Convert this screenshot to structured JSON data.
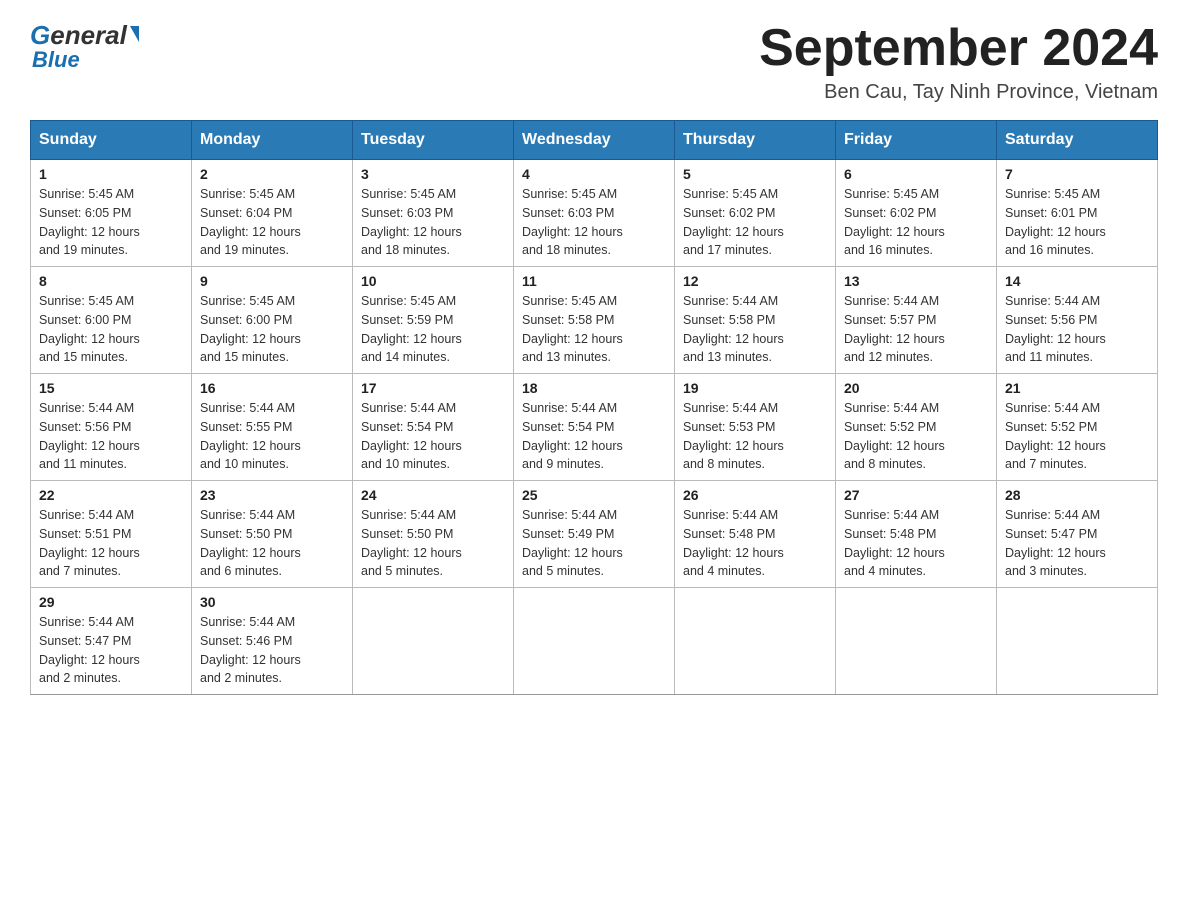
{
  "header": {
    "logo_general": "General",
    "logo_blue": "Blue",
    "main_title": "September 2024",
    "subtitle": "Ben Cau, Tay Ninh Province, Vietnam"
  },
  "columns": [
    "Sunday",
    "Monday",
    "Tuesday",
    "Wednesday",
    "Thursday",
    "Friday",
    "Saturday"
  ],
  "weeks": [
    [
      {
        "day": "1",
        "sunrise": "5:45 AM",
        "sunset": "6:05 PM",
        "daylight": "12 hours and 19 minutes."
      },
      {
        "day": "2",
        "sunrise": "5:45 AM",
        "sunset": "6:04 PM",
        "daylight": "12 hours and 19 minutes."
      },
      {
        "day": "3",
        "sunrise": "5:45 AM",
        "sunset": "6:03 PM",
        "daylight": "12 hours and 18 minutes."
      },
      {
        "day": "4",
        "sunrise": "5:45 AM",
        "sunset": "6:03 PM",
        "daylight": "12 hours and 18 minutes."
      },
      {
        "day": "5",
        "sunrise": "5:45 AM",
        "sunset": "6:02 PM",
        "daylight": "12 hours and 17 minutes."
      },
      {
        "day": "6",
        "sunrise": "5:45 AM",
        "sunset": "6:02 PM",
        "daylight": "12 hours and 16 minutes."
      },
      {
        "day": "7",
        "sunrise": "5:45 AM",
        "sunset": "6:01 PM",
        "daylight": "12 hours and 16 minutes."
      }
    ],
    [
      {
        "day": "8",
        "sunrise": "5:45 AM",
        "sunset": "6:00 PM",
        "daylight": "12 hours and 15 minutes."
      },
      {
        "day": "9",
        "sunrise": "5:45 AM",
        "sunset": "6:00 PM",
        "daylight": "12 hours and 15 minutes."
      },
      {
        "day": "10",
        "sunrise": "5:45 AM",
        "sunset": "5:59 PM",
        "daylight": "12 hours and 14 minutes."
      },
      {
        "day": "11",
        "sunrise": "5:45 AM",
        "sunset": "5:58 PM",
        "daylight": "12 hours and 13 minutes."
      },
      {
        "day": "12",
        "sunrise": "5:44 AM",
        "sunset": "5:58 PM",
        "daylight": "12 hours and 13 minutes."
      },
      {
        "day": "13",
        "sunrise": "5:44 AM",
        "sunset": "5:57 PM",
        "daylight": "12 hours and 12 minutes."
      },
      {
        "day": "14",
        "sunrise": "5:44 AM",
        "sunset": "5:56 PM",
        "daylight": "12 hours and 11 minutes."
      }
    ],
    [
      {
        "day": "15",
        "sunrise": "5:44 AM",
        "sunset": "5:56 PM",
        "daylight": "12 hours and 11 minutes."
      },
      {
        "day": "16",
        "sunrise": "5:44 AM",
        "sunset": "5:55 PM",
        "daylight": "12 hours and 10 minutes."
      },
      {
        "day": "17",
        "sunrise": "5:44 AM",
        "sunset": "5:54 PM",
        "daylight": "12 hours and 10 minutes."
      },
      {
        "day": "18",
        "sunrise": "5:44 AM",
        "sunset": "5:54 PM",
        "daylight": "12 hours and 9 minutes."
      },
      {
        "day": "19",
        "sunrise": "5:44 AM",
        "sunset": "5:53 PM",
        "daylight": "12 hours and 8 minutes."
      },
      {
        "day": "20",
        "sunrise": "5:44 AM",
        "sunset": "5:52 PM",
        "daylight": "12 hours and 8 minutes."
      },
      {
        "day": "21",
        "sunrise": "5:44 AM",
        "sunset": "5:52 PM",
        "daylight": "12 hours and 7 minutes."
      }
    ],
    [
      {
        "day": "22",
        "sunrise": "5:44 AM",
        "sunset": "5:51 PM",
        "daylight": "12 hours and 7 minutes."
      },
      {
        "day": "23",
        "sunrise": "5:44 AM",
        "sunset": "5:50 PM",
        "daylight": "12 hours and 6 minutes."
      },
      {
        "day": "24",
        "sunrise": "5:44 AM",
        "sunset": "5:50 PM",
        "daylight": "12 hours and 5 minutes."
      },
      {
        "day": "25",
        "sunrise": "5:44 AM",
        "sunset": "5:49 PM",
        "daylight": "12 hours and 5 minutes."
      },
      {
        "day": "26",
        "sunrise": "5:44 AM",
        "sunset": "5:48 PM",
        "daylight": "12 hours and 4 minutes."
      },
      {
        "day": "27",
        "sunrise": "5:44 AM",
        "sunset": "5:48 PM",
        "daylight": "12 hours and 4 minutes."
      },
      {
        "day": "28",
        "sunrise": "5:44 AM",
        "sunset": "5:47 PM",
        "daylight": "12 hours and 3 minutes."
      }
    ],
    [
      {
        "day": "29",
        "sunrise": "5:44 AM",
        "sunset": "5:47 PM",
        "daylight": "12 hours and 2 minutes."
      },
      {
        "day": "30",
        "sunrise": "5:44 AM",
        "sunset": "5:46 PM",
        "daylight": "12 hours and 2 minutes."
      },
      {
        "day": "",
        "sunrise": "",
        "sunset": "",
        "daylight": ""
      },
      {
        "day": "",
        "sunrise": "",
        "sunset": "",
        "daylight": ""
      },
      {
        "day": "",
        "sunrise": "",
        "sunset": "",
        "daylight": ""
      },
      {
        "day": "",
        "sunrise": "",
        "sunset": "",
        "daylight": ""
      },
      {
        "day": "",
        "sunrise": "",
        "sunset": "",
        "daylight": ""
      }
    ]
  ],
  "labels": {
    "sunrise_prefix": "Sunrise: ",
    "sunset_prefix": "Sunset: ",
    "daylight_prefix": "Daylight: "
  }
}
